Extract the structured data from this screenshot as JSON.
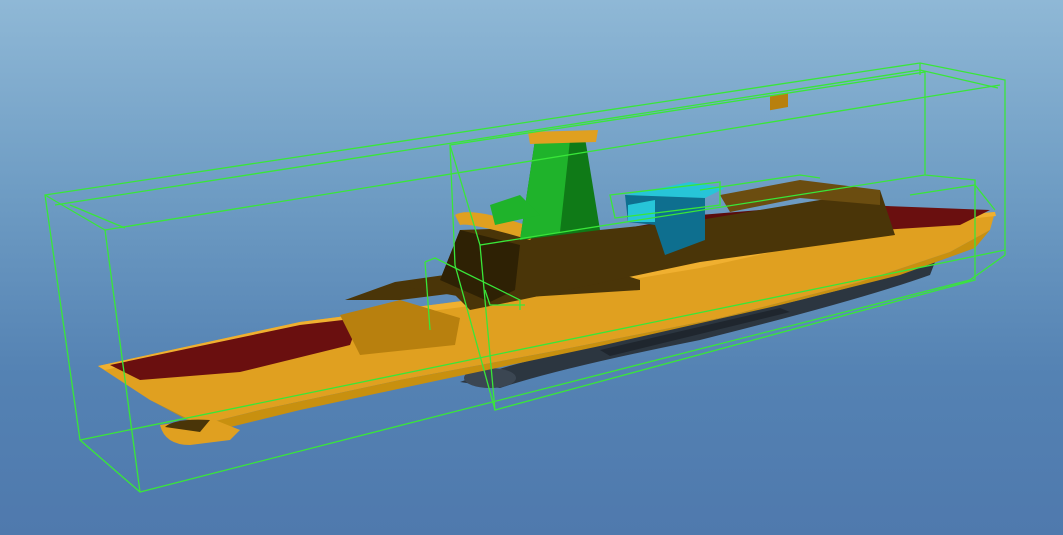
{
  "scene": {
    "object": "ship-model",
    "background_top": "#8fb8d6",
    "background_bottom": "#4f79ad",
    "bounding_box_color": "#39e639",
    "colors": {
      "hull": "#e0a020",
      "hull_shade": "#b8800e",
      "deck": "#6a0f0f",
      "superstructure": "#4a3508",
      "superstructure_light": "#6b4d10",
      "mast": "#1fb32b",
      "mast_dark": "#0f7a17",
      "radar_block": "#0e6f8f",
      "radar_top": "#27c5d8",
      "keel": "#2c3640"
    }
  }
}
